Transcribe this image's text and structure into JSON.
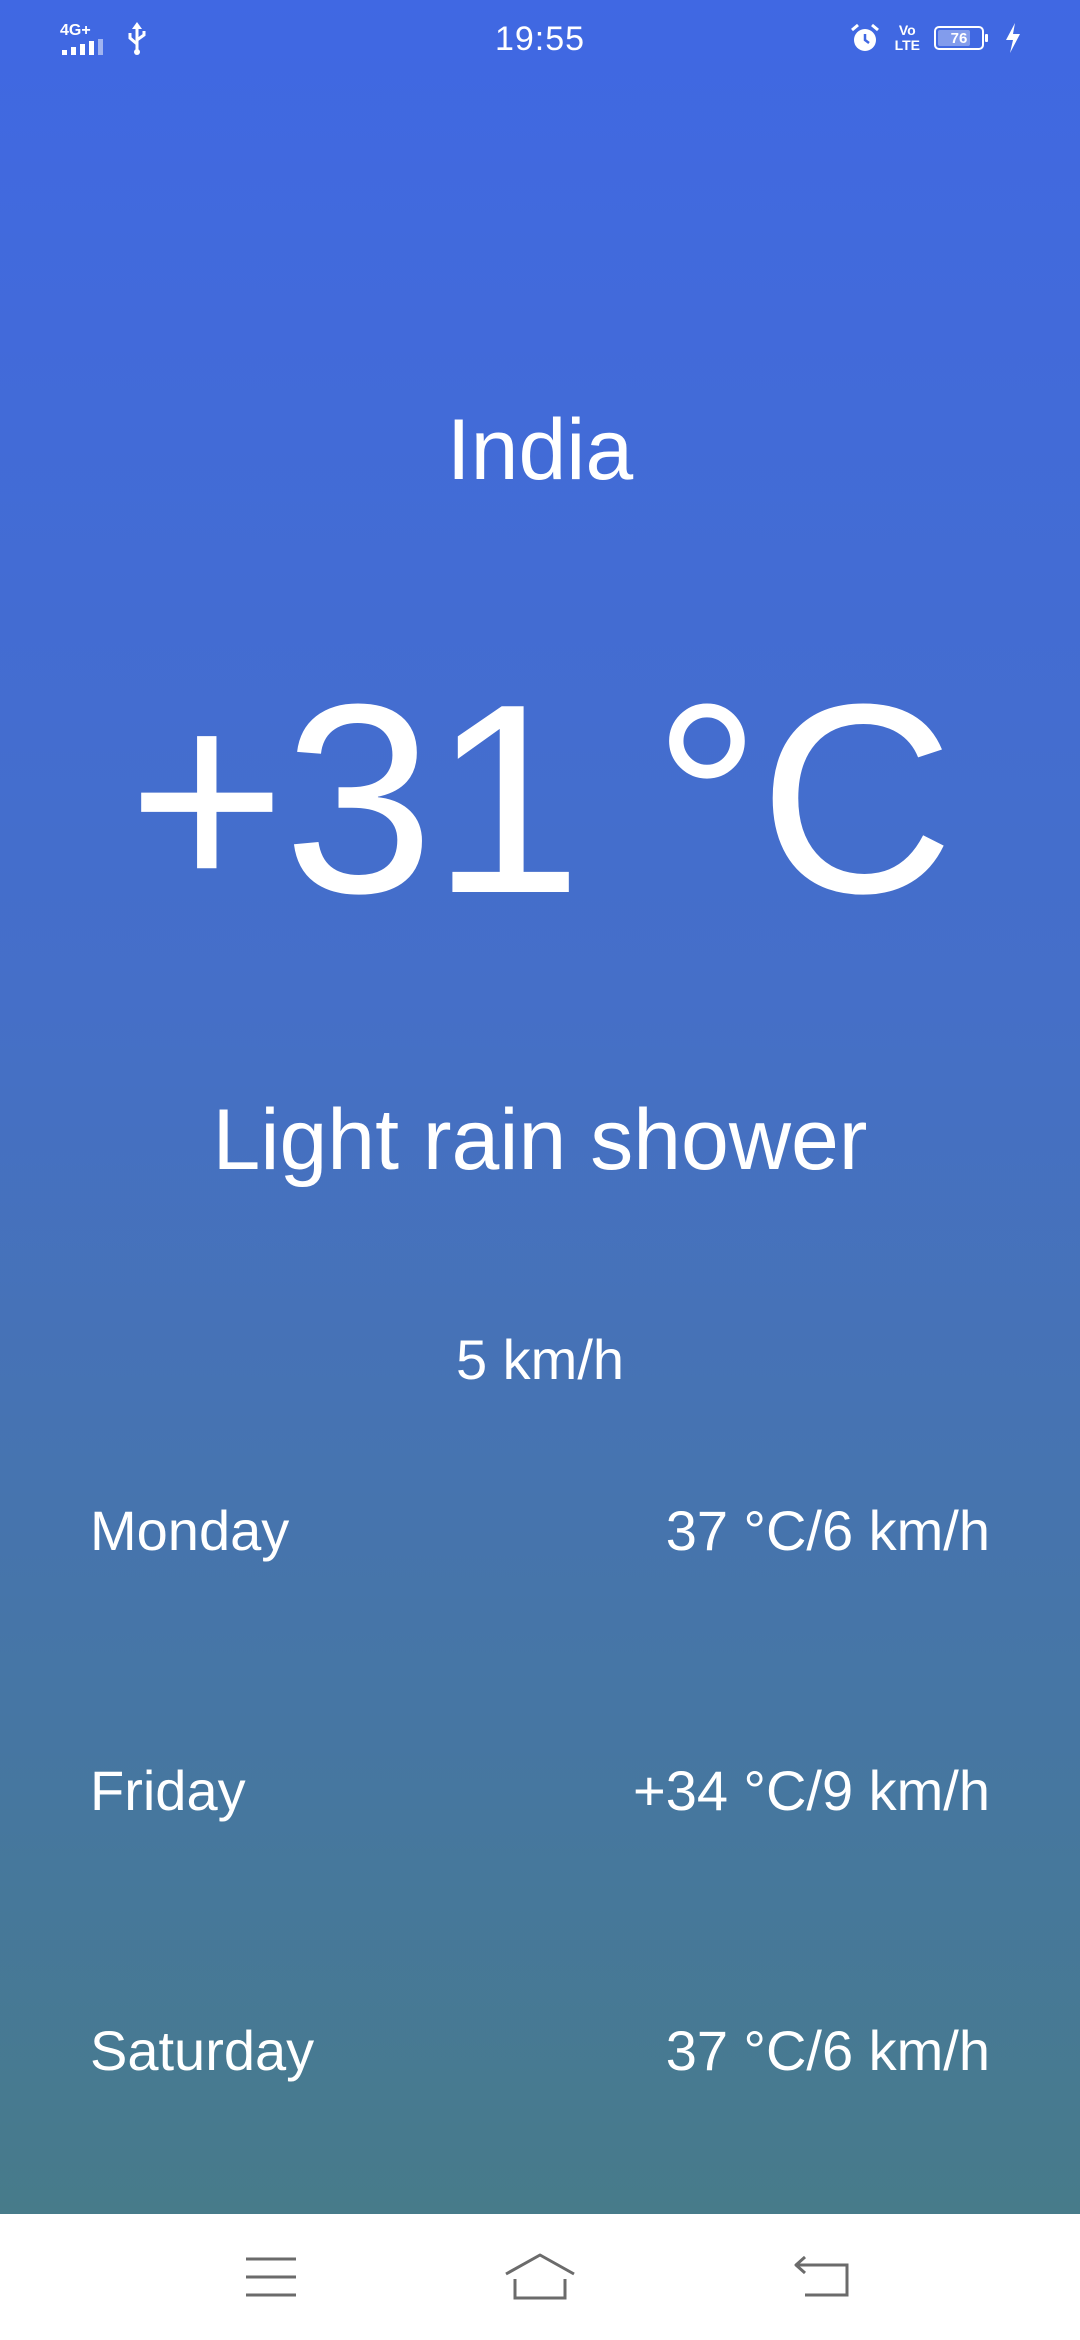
{
  "status_bar": {
    "network": "4G+",
    "time": "19:55",
    "volte_top": "Vo",
    "volte_bottom": "LTE",
    "battery_level": "76",
    "battery_fraction": 0.76
  },
  "weather": {
    "city": "India",
    "temperature": "+31 °C",
    "condition": "Light rain shower",
    "wind": "5 km/h"
  },
  "forecast": [
    {
      "day": "Monday",
      "value": "37 °C/6 km/h"
    },
    {
      "day": "Friday",
      "value": "+34 °C/9 km/h"
    },
    {
      "day": "Saturday",
      "value": "37 °C/6 km/h"
    }
  ],
  "icons": {
    "signal": "signal-icon",
    "usb": "usb-icon",
    "alarm": "alarm-icon",
    "charging": "charging-icon",
    "menu": "menu-icon",
    "home": "home-icon",
    "back": "back-icon"
  },
  "colors": {
    "gradient_top": "#4068e3",
    "gradient_bottom": "#477b8a",
    "text": "#ffffff",
    "navbar_bg": "#ffffff",
    "nav_icon": "#6b6b6b"
  }
}
